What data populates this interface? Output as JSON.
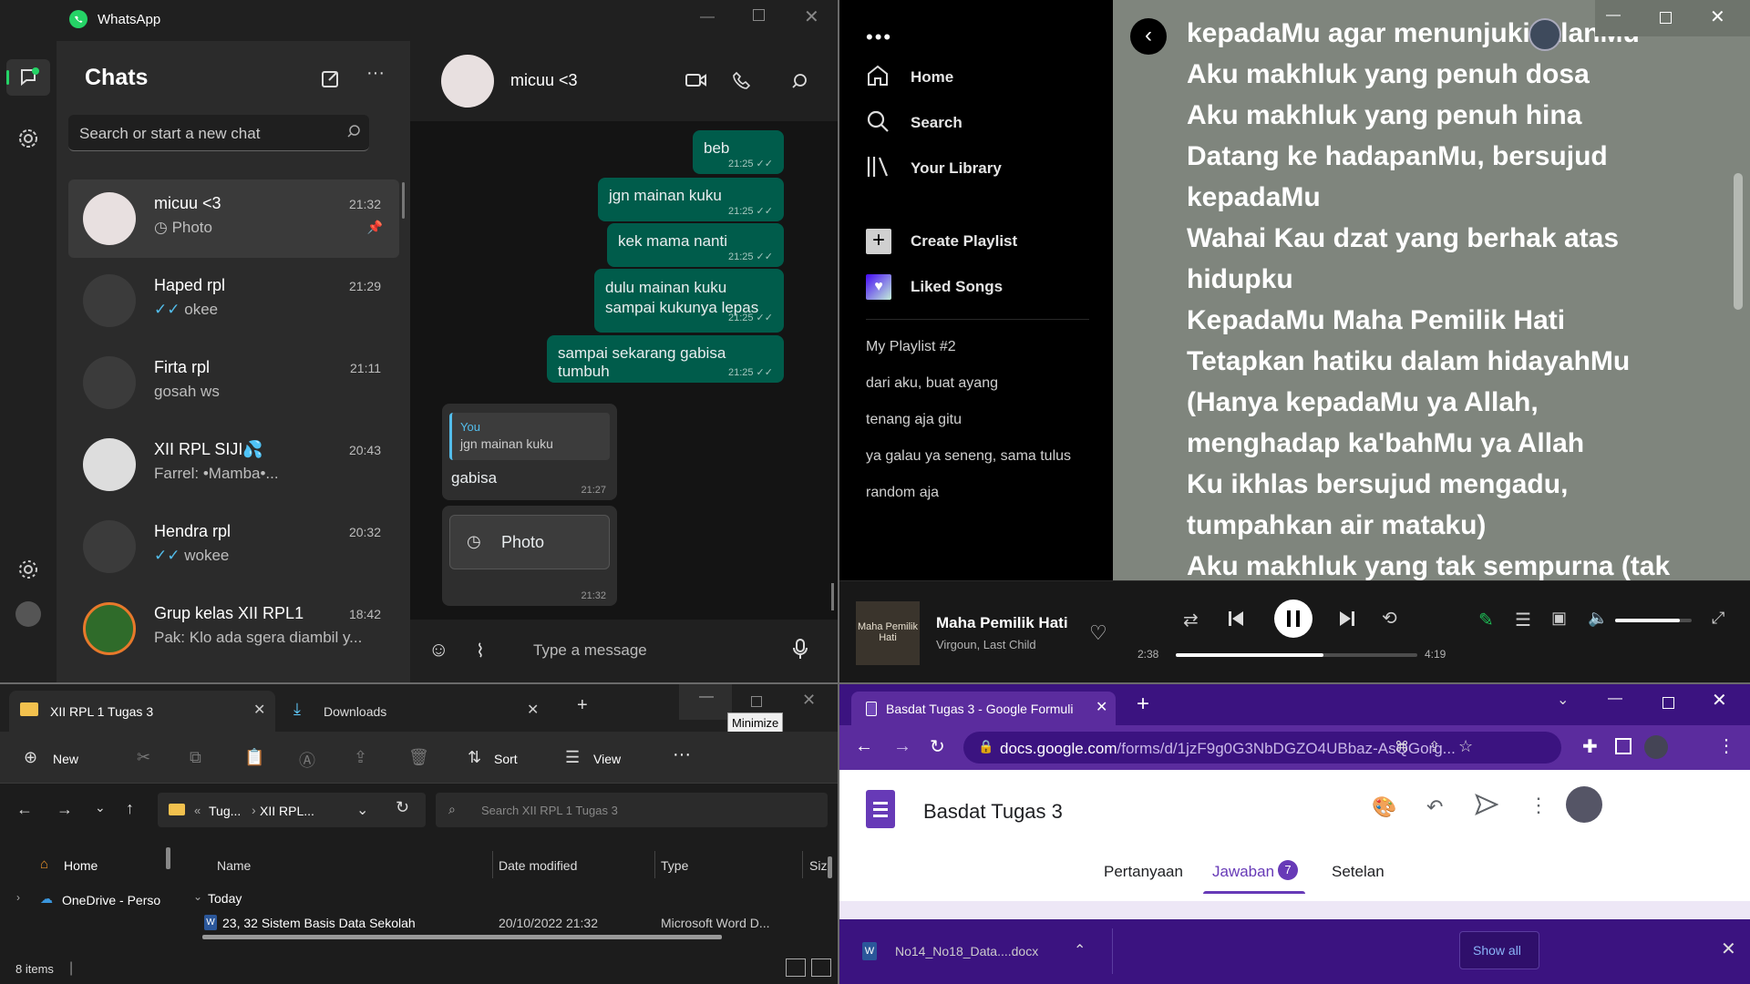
{
  "whatsapp": {
    "app_title": "WhatsApp",
    "chats_title": "Chats",
    "search_placeholder": "Search or start a new chat",
    "chats": [
      {
        "name": "micuu <3",
        "preview": "Photo",
        "time": "21:32"
      },
      {
        "name": "Haped rpl",
        "preview": "okee",
        "time": "21:29"
      },
      {
        "name": "Firta rpl",
        "preview": "gosah ws",
        "time": "21:11"
      },
      {
        "name": "XII RPL SIJI💦",
        "preview": "Farrel: •Mamba•...",
        "time": "20:43"
      },
      {
        "name": "Hendra rpl",
        "preview": "wokee",
        "time": "20:32"
      },
      {
        "name": "Grup kelas XII RPL1",
        "preview": "Pak: Klo ada sgera diambil y...",
        "time": "18:42"
      }
    ],
    "contact_name": "micuu <3",
    "messages_out": [
      {
        "text": "beb",
        "time": "21:25"
      },
      {
        "text": "jgn mainan kuku",
        "time": "21:25"
      },
      {
        "text": "kek mama nanti",
        "time": "21:25"
      },
      {
        "text": "dulu mainan kuku sampai kukunya lepas",
        "time": "21:25"
      },
      {
        "text": "sampai sekarang gabisa tumbuh",
        "time": "21:25"
      }
    ],
    "reply": {
      "quote_author": "You",
      "quote_text": "jgn mainan kuku",
      "text": "gabisa",
      "time": "21:27"
    },
    "photo_msg": {
      "text": "Photo",
      "time": "21:32"
    },
    "message_placeholder": "Type a message"
  },
  "spotify": {
    "nav": [
      "Home",
      "Search",
      "Your Library"
    ],
    "create_playlist": "Create Playlist",
    "liked_songs": "Liked Songs",
    "playlists": [
      "My Playlist #2",
      "dari aku, buat ayang",
      "tenang aja gitu",
      "ya galau ya seneng, sama tulus",
      "random aja"
    ],
    "lyrics": [
      "kepadaMu agar menunjuki jalanMu",
      "Aku makhluk yang penuh dosa",
      "Aku makhluk yang penuh hina",
      "Datang ke hadapanMu, bersujud",
      "kepadaMu",
      "Wahai Kau dzat yang berhak atas",
      "hidupku",
      "KepadaMu Maha Pemilik Hati",
      "Tetapkan hatiku dalam hidayahMu",
      "(Hanya kepadaMu ya Allah,",
      "menghadap ka'bahMu ya Allah",
      "Ku ikhlas bersujud mengadu,",
      "tumpahkan air mataku)",
      "Aku makhluk yang tak sempurna (tak"
    ],
    "track": {
      "title": "Maha Pemilik Hati",
      "artist": "Virgoun, Last Child",
      "album_art_text": "Maha Pemilik Hati",
      "elapsed": "2:38",
      "duration": "4:19",
      "progress": 0.61
    },
    "volume": 0.85,
    "lyrics_bg": "#7f857d",
    "accent": "#1db954"
  },
  "explorer": {
    "tabs": [
      "XII RPL 1 Tugas 3",
      "Downloads"
    ],
    "tooltip": "Minimize",
    "toolbar": {
      "new": "New",
      "sort": "Sort",
      "view": "View"
    },
    "breadcrumb": [
      "Tug...",
      "XII RPL..."
    ],
    "search_placeholder": "Search XII RPL 1 Tugas 3",
    "nav_items": [
      "Home",
      "OneDrive - Perso"
    ],
    "columns": [
      "Name",
      "Date modified",
      "Type",
      "Siz"
    ],
    "group": "Today",
    "files": [
      {
        "name": "23, 32 Sistem Basis Data Sekolah",
        "date": "20/10/2022 21:32",
        "type": "Microsoft Word D..."
      }
    ],
    "status": "8 items"
  },
  "chrome": {
    "tab_title": "Basdat Tugas 3 - Google Formuli",
    "url_domain": "docs.google.com",
    "url_path": "/forms/d/1jzF9g0G3NbDGZO4UBbaz-AsQGorg...",
    "form_title": "Basdat Tugas 3",
    "form_tabs": [
      "Pertanyaan",
      "Jawaban",
      "Setelan"
    ],
    "responses_badge": "7",
    "download_file": "No14_No18_Data....docx",
    "show_all": "Show all",
    "theme": "#3b1380"
  }
}
